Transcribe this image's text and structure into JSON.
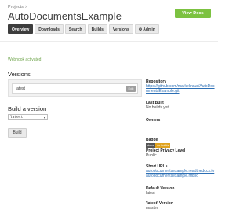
{
  "header": {
    "breadcrumb": "Projects",
    "breadcrumb_sep": ">",
    "title": "AutoDocumentsExample",
    "view_docs_label": "View Docs"
  },
  "tabs": [
    {
      "label": "Overview",
      "active": true
    },
    {
      "label": "Downloads",
      "active": false
    },
    {
      "label": "Search",
      "active": false
    },
    {
      "label": "Builds",
      "active": false
    },
    {
      "label": "Versions",
      "active": false
    },
    {
      "label": "Admin",
      "active": false,
      "icon": "gear-icon"
    }
  ],
  "notice": "Webhook activated",
  "versions": {
    "heading": "Versions",
    "items": [
      {
        "name": "latest",
        "edit_label": "Edit"
      }
    ]
  },
  "build": {
    "heading": "Build a version",
    "selected": "latest",
    "button_label": "Build"
  },
  "sidebar": {
    "repository_label": "Repository",
    "repository_url": "https://github.com/markekraus/AutoDocumentsExample.git",
    "last_built_label": "Last Built",
    "last_built_value": "No builds yet",
    "owners_label": "Owners",
    "badge_label": "Badge",
    "badge_left": "docs",
    "badge_right": "no builds",
    "privacy_label": "Project Privacy Level",
    "privacy_value": "Public",
    "short_urls_label": "Short URLs",
    "short_url_1": "autodocumentsexample.readthedocs.io",
    "short_url_2": "autodocumentsexample.rtfd.io",
    "default_version_label": "Default Version",
    "default_version_value": "latest",
    "latest_version_label": "'latest' Version",
    "latest_version_value": "master"
  },
  "colors": {
    "primary_button": "#7cc241",
    "active_tab": "#3d3d3d",
    "notice_text": "#6ea44b",
    "link": "#2c6fb5"
  }
}
